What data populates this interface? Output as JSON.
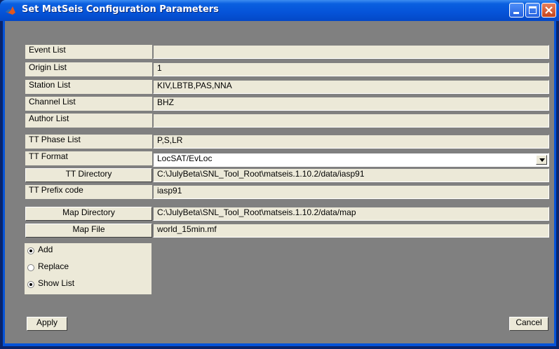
{
  "window": {
    "title": "Set MatSeis Configuration Parameters"
  },
  "lists": [
    {
      "label": "Event List",
      "value": ""
    },
    {
      "label": "Origin List",
      "value": "1"
    },
    {
      "label": "Station List",
      "value": "KIV,LBTB,PAS,NNA"
    },
    {
      "label": "Channel List",
      "value": "BHZ"
    },
    {
      "label": "Author List",
      "value": ""
    }
  ],
  "tt": {
    "phase_label": "TT Phase List",
    "phase_value": "P,S,LR",
    "format_label": "TT Format",
    "format_value": "LocSAT/EvLoc",
    "directory_button": "TT Directory",
    "directory_value": "C:\\JulyBeta\\SNL_Tool_Root\\matseis.1.10.2/data/iasp91",
    "prefix_label": "TT Prefix code",
    "prefix_value": "iasp91"
  },
  "map": {
    "directory_button": "Map Directory",
    "directory_value": "C:\\JulyBeta\\SNL_Tool_Root\\matseis.1.10.2/data/map",
    "file_button": "Map File",
    "file_value": "world_15min.mf"
  },
  "mode": {
    "options": [
      {
        "label": "Add",
        "selected": true
      },
      {
        "label": "Replace",
        "selected": false
      },
      {
        "label": "Show List",
        "selected": true
      }
    ]
  },
  "buttons": {
    "apply": "Apply",
    "cancel": "Cancel"
  },
  "icons": {
    "app": "matlab-logo-icon",
    "minimize": "minimize-icon",
    "maximize": "maximize-icon",
    "close": "close-icon"
  }
}
